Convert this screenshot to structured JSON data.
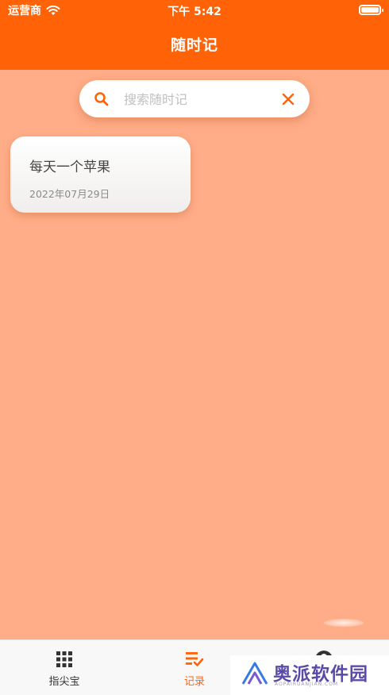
{
  "status_bar": {
    "carrier": "运营商",
    "time": "下午 5:42"
  },
  "header": {
    "title": "随时记"
  },
  "search": {
    "placeholder": "搜索随时记",
    "value": ""
  },
  "notes": [
    {
      "title": "每天一个苹果",
      "date": "2022年07月29日"
    }
  ],
  "tab_bar": {
    "tabs": [
      {
        "label": "指尖宝",
        "icon": "grid-icon",
        "active": false
      },
      {
        "label": "记录",
        "icon": "checklist-icon",
        "active": true
      },
      {
        "label": "",
        "icon": "profile-icon",
        "active": false
      }
    ]
  },
  "watermark": {
    "text": "奥派软件园",
    "sub": "AOPAIRUANJIAN.COM"
  },
  "colors": {
    "primary": "#ff6207",
    "background": "#ffad88",
    "watermark": "#5a4ba8"
  }
}
